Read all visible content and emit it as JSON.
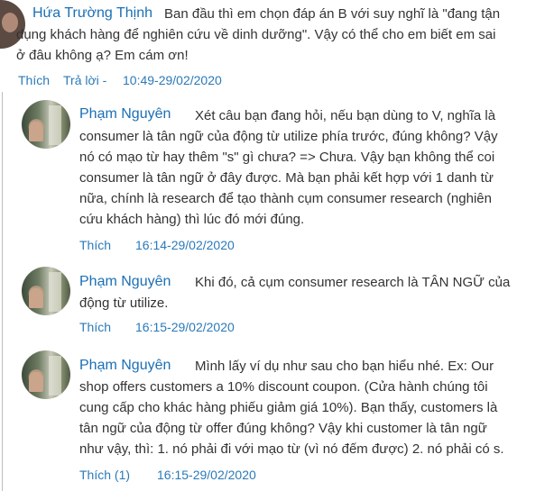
{
  "comments": [
    {
      "author": "Hứa Trường Thịnh",
      "text_lines": [
        "Ban đầu thì em chọn đáp án B với suy nghĩ là \"đang tận",
        "dụng khách hàng để nghiên cứu về dinh dưỡng\". Vậy có thể cho em biết em sai",
        "ở đâu không ạ? Em cám ơn!"
      ],
      "like": "Thích",
      "reply": "Trả lời -",
      "time": "10:49-29/02/2020"
    }
  ],
  "replies": [
    {
      "author": "Phạm Nguyên",
      "text_lines": [
        "Xét câu bạn đang hỏi, nếu bạn dùng to V, nghĩa là",
        "consumer là tân ngữ của động từ utilize phía trước, đúng không? Vậy",
        "nó có mạo từ hay thêm \"s\" gì chưa? => Chưa. Vậy bạn không thể coi",
        "consumer là tân ngữ ở đây được. Mà bạn phải kết hợp với 1 danh từ",
        "nữa, chính là research để tạo thành cụm consumer research (nghiên",
        "cứu khách hàng) thì lúc đó mới đúng."
      ],
      "like": "Thích",
      "time": "16:14-29/02/2020"
    },
    {
      "author": "Phạm Nguyên",
      "text_lines": [
        "Khi đó, cả cụm consumer research là TÂN NGỮ của",
        "động từ utilize."
      ],
      "like": "Thích",
      "time": "16:15-29/02/2020"
    },
    {
      "author": "Phạm Nguyên",
      "text_lines": [
        "Mình lấy ví dụ như sau cho bạn hiểu nhé. Ex: Our",
        "shop offers customers a 10% discount coupon. (Cửa hành chúng tôi",
        "cung cấp cho khác hàng phiếu giảm giá 10%). Bạn thấy, customers là",
        "tân ngữ của động từ offer đúng không? Vậy khi customer là tân ngữ",
        "như vậy, thì: 1. nó phải đi với mạo từ (vì nó đếm được) 2. nó phải có s."
      ],
      "like": "Thích (1)",
      "time": "16:15-29/02/2020"
    }
  ]
}
